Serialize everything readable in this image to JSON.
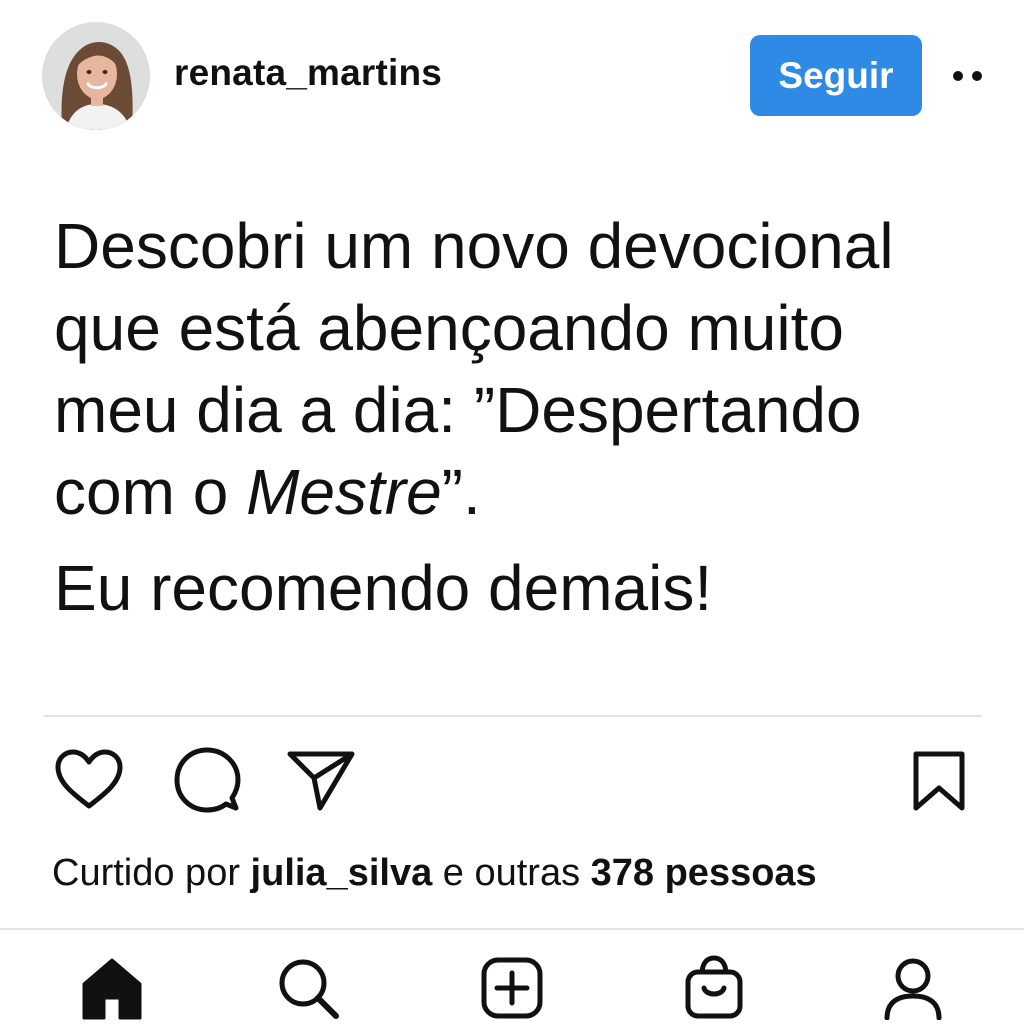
{
  "header": {
    "username": "renata_martins",
    "follow_label": "Seguir"
  },
  "post": {
    "line1": "Descobri um novo devocional",
    "line2": "que está abençoando muito",
    "line3": "meu dia a dia: ”Despertando",
    "line4_prefix": "com o ",
    "line4_italic": "Mestre",
    "line4_suffix": "”.",
    "line5": "Eu recomendo demais!"
  },
  "likes": {
    "prefix": "Curtido por ",
    "user": "julia_silva",
    "middle": " e outras ",
    "count": "378 pessoas"
  },
  "icons": {
    "like": "heart-icon",
    "comment": "comment-icon",
    "share": "send-icon",
    "save": "bookmark-icon",
    "more": "more-options-icon"
  },
  "nav": [
    "home-icon",
    "search-icon",
    "create-icon",
    "shop-icon",
    "profile-icon"
  ],
  "colors": {
    "accent": "#2f8ae5",
    "text": "#111111",
    "divider": "#e2e2e2"
  }
}
